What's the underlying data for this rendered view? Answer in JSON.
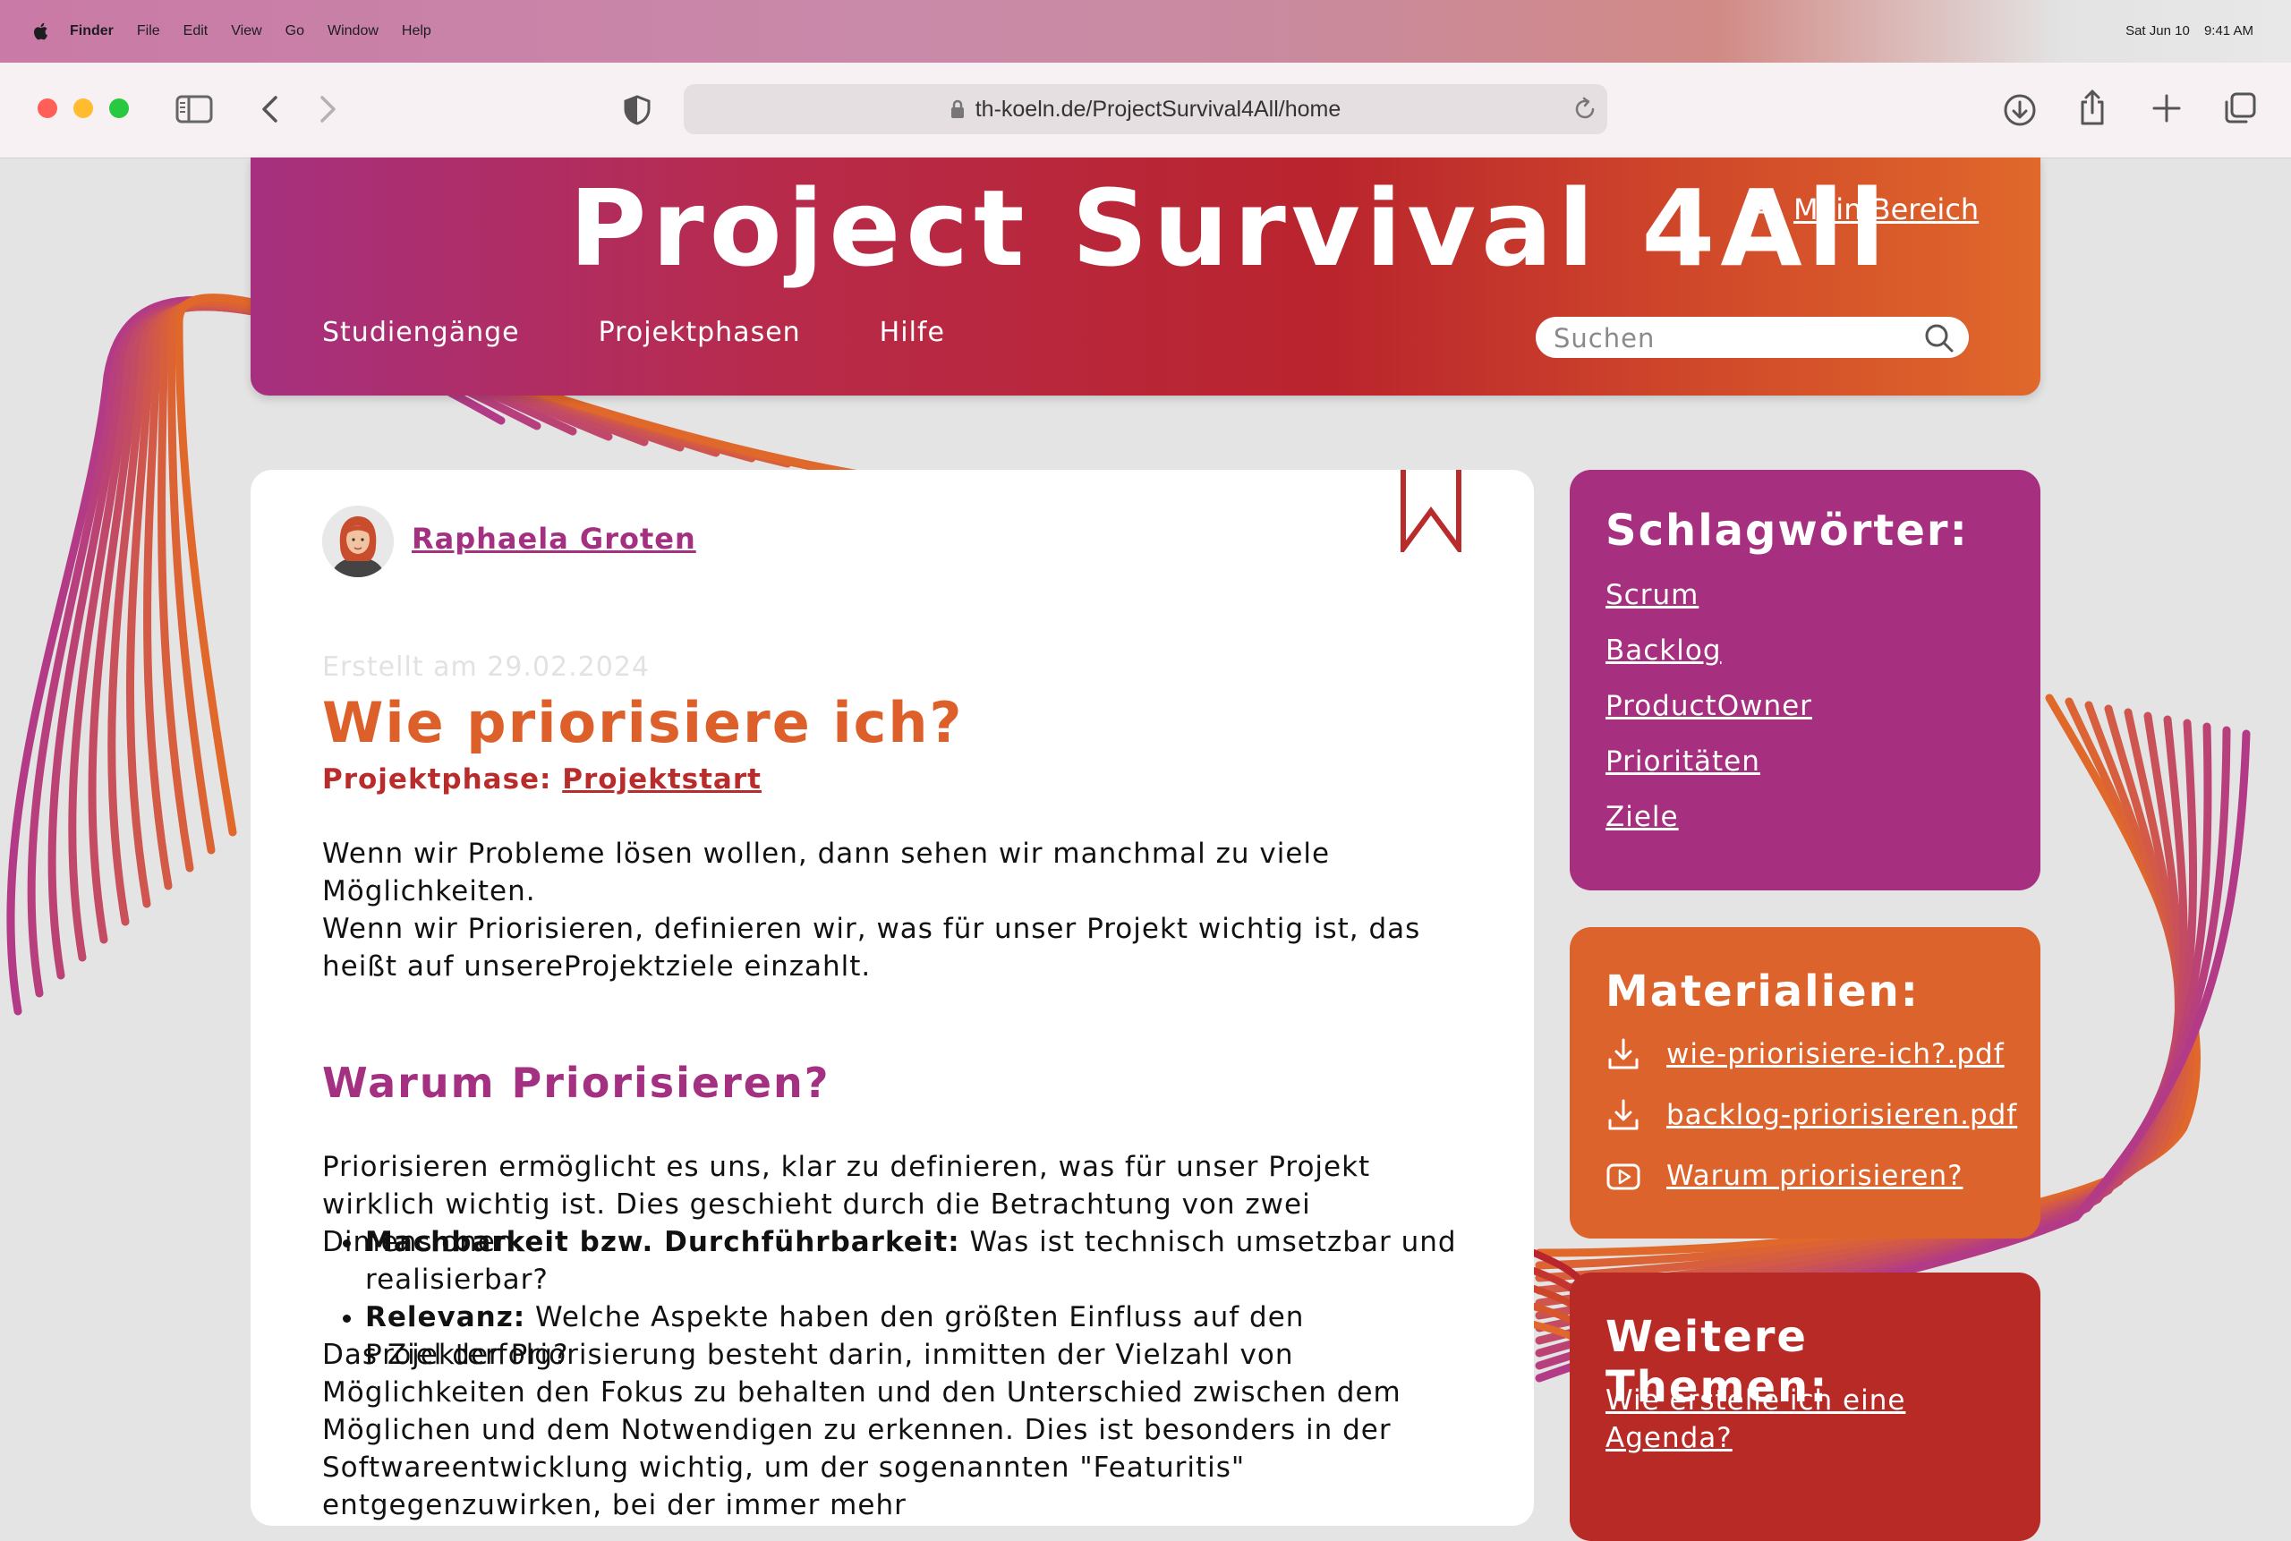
{
  "menubar": {
    "app": "Finder",
    "items": [
      "File",
      "Edit",
      "View",
      "Go",
      "Window",
      "Help"
    ],
    "date": "Sat Jun 10",
    "time": "9:41 AM"
  },
  "browser": {
    "url": "th-koeln.de/ProjectSurvival4All/home"
  },
  "site": {
    "title": "Project Survival 4All",
    "account_label": "Mein Bereich",
    "nav": [
      "Studiengänge",
      "Projektphasen",
      "Hilfe"
    ],
    "search_placeholder": "Suchen"
  },
  "article": {
    "author": "Raphaela Groten",
    "created": "Erstellt am 29.02.2024",
    "title": "Wie priorisiere ich?",
    "phase_label": "Projektphase:",
    "phase_link": "Projektstart",
    "intro_line1": "Wenn wir Probleme lösen wollen, dann sehen wir manchmal zu viele Möglichkeiten.",
    "intro_line2": "Wenn wir Priorisieren, definieren wir, was für unser Projekt wichtig ist, das heißt auf unsereProjektziele einzahlt.",
    "section_heading": "Warum Priorisieren?",
    "section_text": "Priorisieren ermöglicht es uns, klar zu definieren, was für unser Projekt wirklich wichtig ist. Dies geschieht durch die Betrachtung von zwei Dimensionen:",
    "bullets": [
      {
        "term": "Machbarkeit bzw. Durchführbarkeit:",
        "text": " Was ist technisch umsetzbar und realisierbar?"
      },
      {
        "term": "Relevanz:",
        "text": " Welche Aspekte haben den größten Einfluss auf den Projekterfolg?"
      }
    ],
    "closing": "Das Ziel der Priorisierung besteht darin, inmitten der Vielzahl von Möglichkeiten den Fokus zu behalten und den Unterschied zwischen dem Möglichen und dem Notwendigen zu erkennen. Dies ist besonders in der Softwareentwicklung wichtig, um der sogenannten \"Featuritis\" entgegenzuwirken, bei der immer mehr"
  },
  "sidebar": {
    "tags_title": "Schlagwörter:",
    "tags": [
      "Scrum",
      "Backlog",
      "ProductOwner",
      "Prioritäten",
      "Ziele"
    ],
    "materials_title": "Materialien:",
    "materials": [
      {
        "label": "wie-priorisiere-ich?.pdf",
        "icon": "download-icon"
      },
      {
        "label": "backlog-priorisieren.pdf",
        "icon": "download-icon"
      },
      {
        "label": "Warum priorisieren?",
        "icon": "video-icon"
      }
    ],
    "topics_title": "Weitere Themen:",
    "topics": [
      "Wie erstelle ich eine Agenda?"
    ]
  },
  "colors": {
    "purple": "#a6307f",
    "orange": "#dd632c",
    "red": "#b82a26"
  }
}
